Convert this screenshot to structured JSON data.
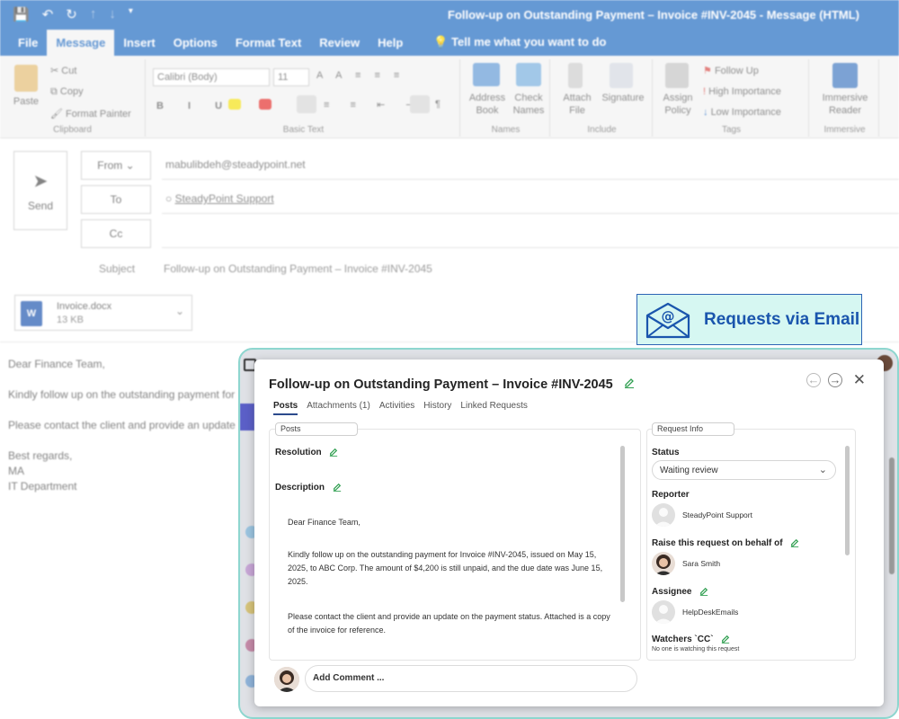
{
  "outlook": {
    "window_title": "Follow-up on Outstanding Payment – Invoice #INV-2045 - Message (HTML)",
    "menu_tabs": [
      "File",
      "Message",
      "Insert",
      "Options",
      "Format Text",
      "Review",
      "Help"
    ],
    "active_tab": "Message",
    "tell_me": "Tell me what you want to do",
    "ribbon": {
      "clipboard": {
        "paste": "Paste",
        "cut": "Cut",
        "copy": "Copy",
        "format_painter": "Format Painter",
        "group": "Clipboard"
      },
      "basic_text": {
        "font": "Calibri (Body)",
        "size": "11",
        "group": "Basic Text"
      },
      "names": {
        "address_book": "Address Book",
        "check_names": "Check Names",
        "group": "Names"
      },
      "include": {
        "attach_file": "Attach File",
        "signature": "Signature",
        "group": "Include"
      },
      "tags": {
        "assign_policy": "Assign Policy",
        "follow_up": "Follow Up",
        "high_importance": "High Importance",
        "low_importance": "Low Importance",
        "group": "Tags"
      },
      "immersive": {
        "immersive_reader": "Immersive Reader",
        "group": "Immersive"
      }
    },
    "compose": {
      "send": "Send",
      "from_label": "From",
      "from_value": "mabulibdeh@steadypoint.net",
      "to_label": "To",
      "to_value": "SteadyPoint Support",
      "cc_label": "Cc",
      "subject_label": "Subject",
      "subject_value": "Follow-up on Outstanding Payment – Invoice #INV-2045",
      "attachment_name": "Invoice.docx",
      "attachment_size": "13 KB",
      "attachment_icon": "W"
    },
    "body_lines": [
      "Dear Finance Team,",
      "Kindly follow up on the outstanding payment for",
      "Please contact the client and provide an update",
      "Best regards,",
      "MA",
      "IT Department"
    ]
  },
  "badge": {
    "text": "Requests via Email",
    "icon": "email-at-icon",
    "bg": "#d6f7f2",
    "color": "#1a55ad"
  },
  "modal": {
    "title": "Follow-up on Outstanding Payment – Invoice #INV-2045",
    "tabs": [
      "Posts",
      "Attachments (1)",
      "Activities",
      "History",
      "Linked Requests"
    ],
    "active_tab": "Posts",
    "posts": {
      "pill": "Posts",
      "resolution_label": "Resolution",
      "description_label": "Description",
      "description_paragraphs": [
        "Dear Finance Team,",
        "Kindly follow up on the outstanding payment for Invoice #INV-2045, issued on May 15, 2025, to ABC Corp. The amount of $4,200 is still unpaid, and the due date was June 15, 2025.",
        "Please contact the client and provide an update on the payment status. Attached is a copy of the invoice for reference."
      ]
    },
    "comment_placeholder": "Add Comment ...",
    "request_info": {
      "pill": "Request Info",
      "status_label": "Status",
      "status_value": "Waiting review",
      "reporter_label": "Reporter",
      "reporter_name": "SteadyPoint Support",
      "behalf_label": "Raise this request on behalf of",
      "behalf_name": "Sara Smith",
      "assignee_label": "Assignee",
      "assignee_name": "HelpDeskEmails",
      "watchers_label": "Watchers `CC`",
      "watchers_note": "No one is watching this request"
    },
    "accent": "#2b4a8c",
    "edit_icon_color": "#2e9e4f"
  }
}
